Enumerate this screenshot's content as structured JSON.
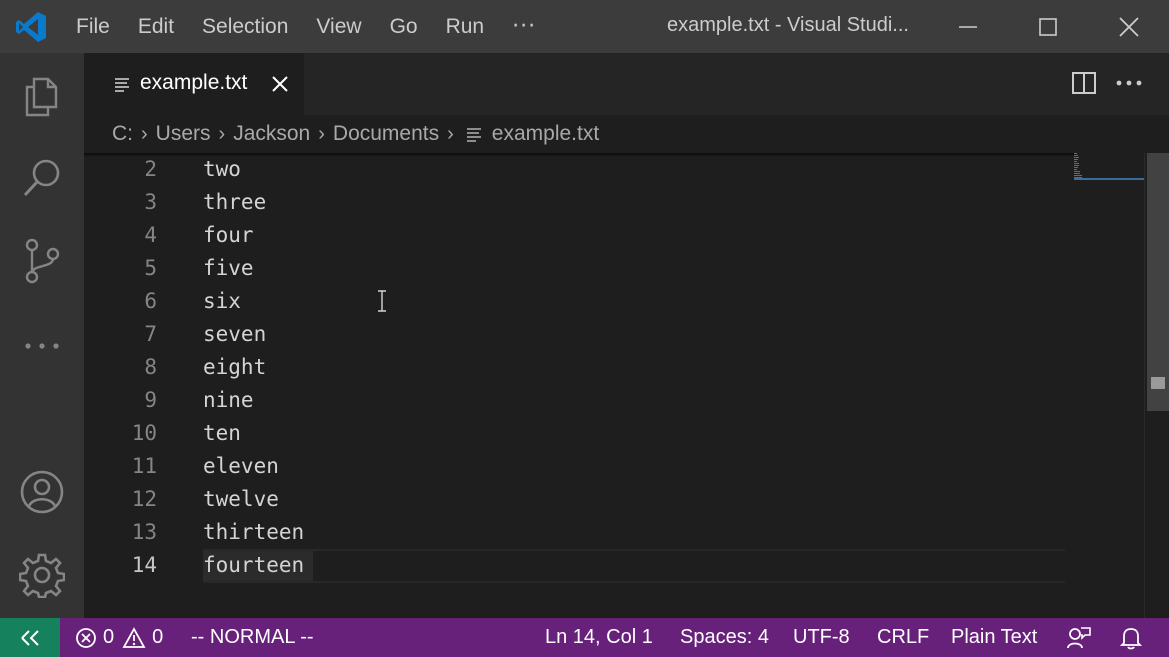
{
  "titlebar": {
    "menu": [
      "File",
      "Edit",
      "Selection",
      "View",
      "Go",
      "Run"
    ],
    "more": "···",
    "window_title": "example.txt - Visual Studi..."
  },
  "tab": {
    "label": "example.txt"
  },
  "breadcrumbs": [
    "C:",
    "Users",
    "Jackson",
    "Documents",
    "example.txt"
  ],
  "editor": {
    "lines": [
      {
        "num": "2",
        "text": "two"
      },
      {
        "num": "3",
        "text": "three"
      },
      {
        "num": "4",
        "text": "four"
      },
      {
        "num": "5",
        "text": "five"
      },
      {
        "num": "6",
        "text": "six"
      },
      {
        "num": "7",
        "text": "seven"
      },
      {
        "num": "8",
        "text": "eight"
      },
      {
        "num": "9",
        "text": "nine"
      },
      {
        "num": "10",
        "text": "ten"
      },
      {
        "num": "11",
        "text": "eleven"
      },
      {
        "num": "12",
        "text": "twelve"
      },
      {
        "num": "13",
        "text": "thirteen"
      },
      {
        "num": "14",
        "text": "fourteen"
      }
    ],
    "active_line": "14"
  },
  "statusbar": {
    "errors": "0",
    "warnings": "0",
    "mode": "-- NORMAL --",
    "position": "Ln 14, Col 1",
    "spaces": "Spaces: 4",
    "encoding": "UTF-8",
    "eol": "CRLF",
    "language": "Plain Text"
  },
  "colors": {
    "titlebar": "#3c3c3c",
    "activitybar": "#333333",
    "editor": "#1e1e1e",
    "statusbar": "#68217a",
    "remote": "#16825d"
  },
  "icons": {
    "activity": [
      "files-icon",
      "search-icon",
      "source-control-icon",
      "more-icon",
      "account-icon",
      "settings-gear-icon"
    ]
  }
}
